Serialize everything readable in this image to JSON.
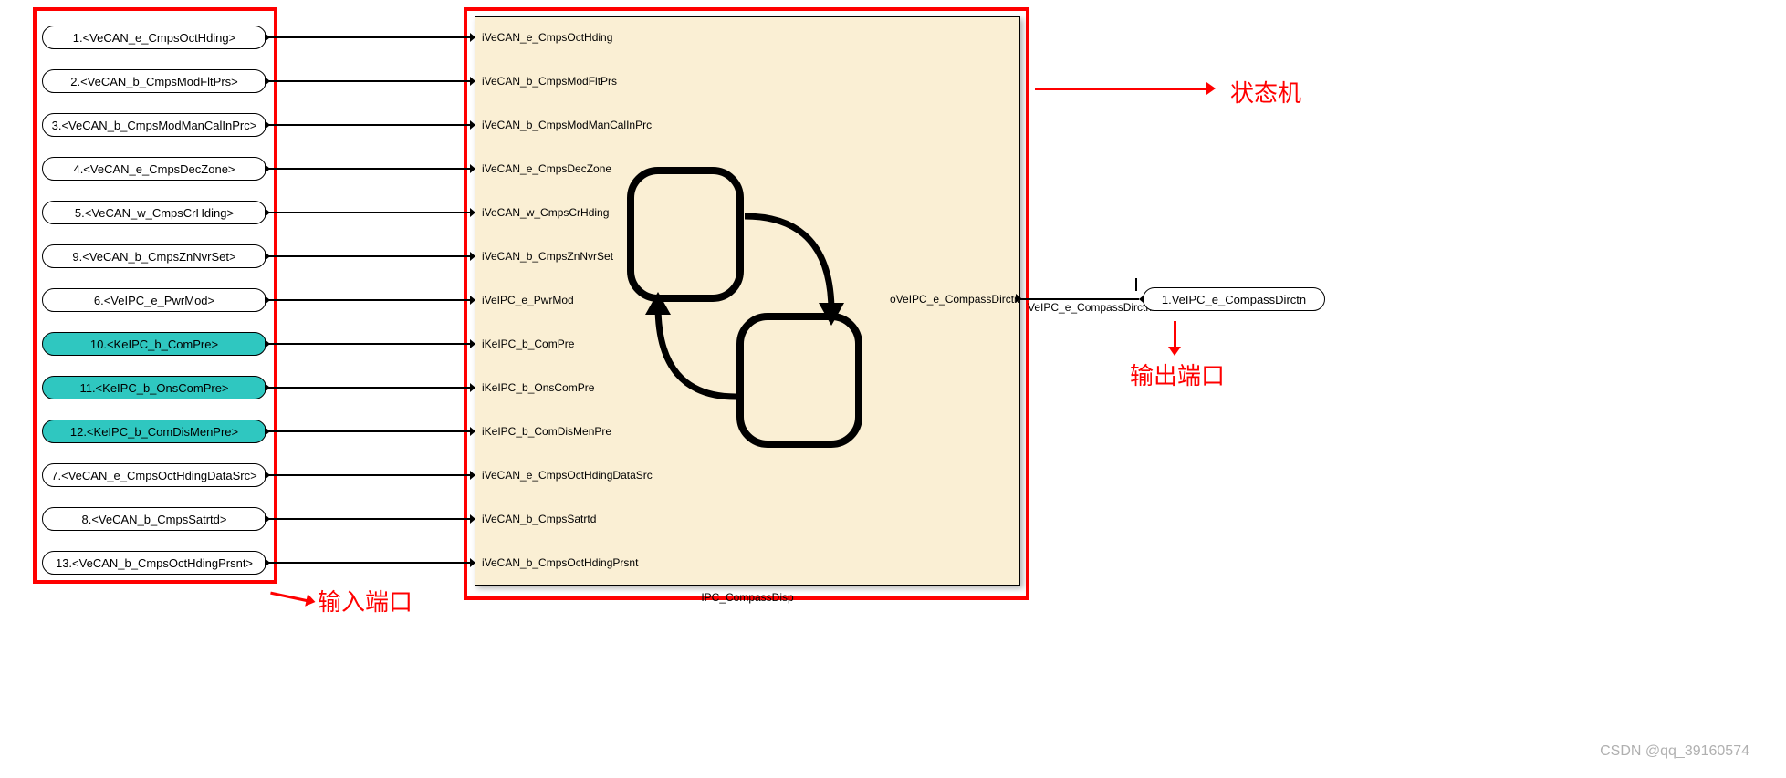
{
  "inputs": [
    {
      "label": "1.<VeCAN_e_CmpsOctHding>",
      "teal": false,
      "portLabel": "iVeCAN_e_CmpsOctHding"
    },
    {
      "label": "2.<VeCAN_b_CmpsModFltPrs>",
      "teal": false,
      "portLabel": "iVeCAN_b_CmpsModFltPrs"
    },
    {
      "label": "3.<VeCAN_b_CmpsModManCalInPrc>",
      "teal": false,
      "portLabel": "iVeCAN_b_CmpsModManCalInPrc"
    },
    {
      "label": "4.<VeCAN_e_CmpsDecZone>",
      "teal": false,
      "portLabel": "iVeCAN_e_CmpsDecZone"
    },
    {
      "label": "5.<VeCAN_w_CmpsCrHding>",
      "teal": false,
      "portLabel": "iVeCAN_w_CmpsCrHding"
    },
    {
      "label": "9.<VeCAN_b_CmpsZnNvrSet>",
      "teal": false,
      "portLabel": "iVeCAN_b_CmpsZnNvrSet"
    },
    {
      "label": "6.<VeIPC_e_PwrMod>",
      "teal": false,
      "portLabel": "iVeIPC_e_PwrMod"
    },
    {
      "label": "10.<KeIPC_b_ComPre>",
      "teal": true,
      "portLabel": "iKeIPC_b_ComPre"
    },
    {
      "label": "11.<KeIPC_b_OnsComPre>",
      "teal": true,
      "portLabel": "iKeIPC_b_OnsComPre"
    },
    {
      "label": "12.<KeIPC_b_ComDisMenPre>",
      "teal": true,
      "portLabel": "iKeIPC_b_ComDisMenPre"
    },
    {
      "label": "7.<VeCAN_e_CmpsOctHdingDataSrc>",
      "teal": false,
      "portLabel": "iVeCAN_e_CmpsOctHdingDataSrc"
    },
    {
      "label": "8.<VeCAN_b_CmpsSatrtd>",
      "teal": false,
      "portLabel": "iVeCAN_b_CmpsSatrtd"
    },
    {
      "label": "13.<VeCAN_b_CmpsOctHdingPrsnt>",
      "teal": false,
      "portLabel": "iVeCAN_b_CmpsOctHdingPrsnt"
    }
  ],
  "chart": {
    "name": "IPC_CompassDisp",
    "outPort": "oVeIPC_e_CompassDirctn",
    "outSignal": "VeIPC_e_CompassDirctn"
  },
  "output": {
    "label": "1.VeIPC_e_CompassDirctn"
  },
  "annotations": {
    "inputPorts": "输入端口",
    "stateMachine": "状态机",
    "outputPort": "输出端口"
  },
  "watermark": "CSDN @qq_39160574"
}
